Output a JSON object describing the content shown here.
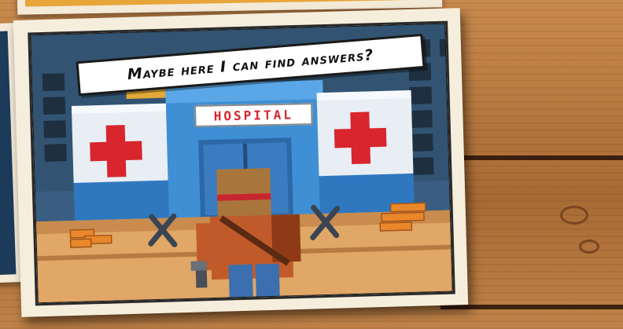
{
  "caption": {
    "text": "Maybe here I can find answers?"
  },
  "building": {
    "sign_text": "HOSPITAL"
  },
  "colors": {
    "sky": "#3a5e82",
    "hospital_blue": "#3f8fd4",
    "hospital_white": "#e8eef4",
    "cross_red": "#d8252e",
    "ground": "#e0a766",
    "character_jacket": "#c15a2a",
    "character_pants": "#3b6fb0"
  },
  "icons": [
    "red-cross-left",
    "red-cross-right",
    "czech-hedgehog-left",
    "czech-hedgehog-right",
    "pistol"
  ]
}
